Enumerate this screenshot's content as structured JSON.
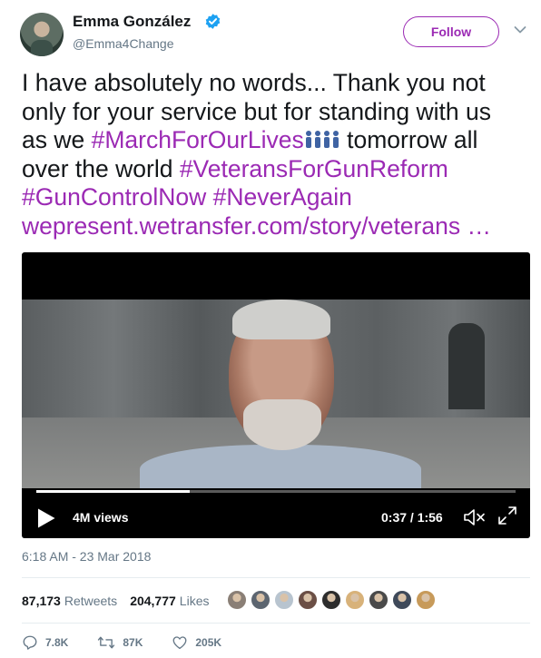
{
  "user": {
    "display_name": "Emma González",
    "handle": "@Emma4Change"
  },
  "follow_label": "Follow",
  "tweet": {
    "line1": "I have absolutely no words... Thank you not",
    "line2": "only for your service but for standing with us",
    "line3_pre": "as we ",
    "hashtag_march": "#MarchForOurLives",
    "line3_post": " tomorrow all",
    "line4_pre": "over the world ",
    "hashtag_veterans": "#VeteransForGunReform",
    "hashtag_guncontrol": "#GunControlNow",
    "hashtag_neveragain": "#NeverAgain",
    "link": "wepresent.wetransfer.com/story/veterans …"
  },
  "video": {
    "views": "4M views",
    "time": "0:37 / 1:56",
    "progress": 0.32
  },
  "timestamp": "6:18 AM - 23 Mar 2018",
  "stats": {
    "retweets_count": "87,173",
    "retweets_label": "Retweets",
    "likes_count": "204,777",
    "likes_label": "Likes"
  },
  "liker_colors": [
    "#8a7f76",
    "#5c6570",
    "#b8c4cf",
    "#6b4f45",
    "#2d2d2d",
    "#d8b27a",
    "#4a4a4a",
    "#3f4a5a",
    "#c79a5a"
  ],
  "actions": {
    "replies": "7.8K",
    "retweets": "87K",
    "likes": "205K"
  },
  "colors": {
    "accent": "#9b2ab4",
    "verified": "#1da1f2",
    "secondary_text": "#657786"
  }
}
